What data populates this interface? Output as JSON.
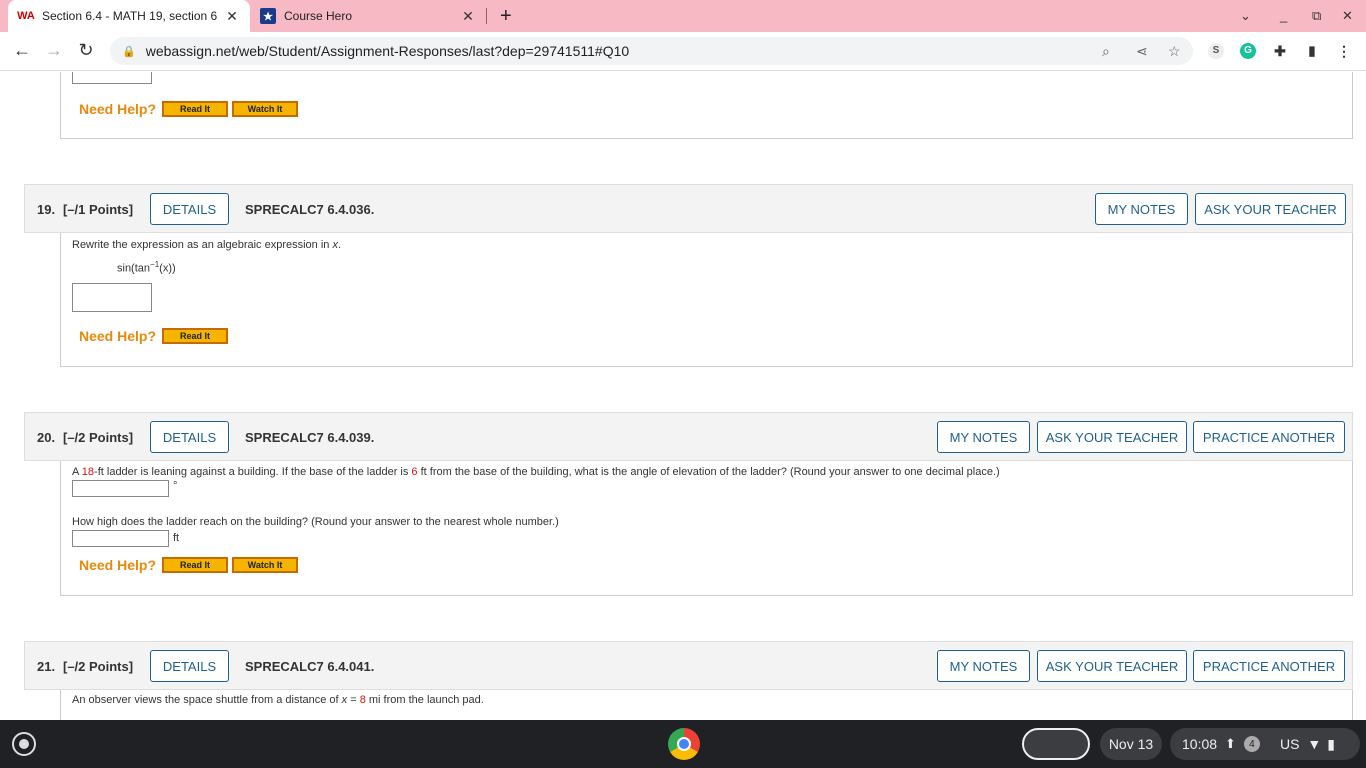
{
  "browser": {
    "tabs": [
      {
        "title": "Section 6.4 - MATH 19, section 6",
        "favicon": "webassign-icon"
      },
      {
        "title": "Course Hero",
        "favicon": "coursehero-icon"
      }
    ],
    "url": "webassign.net/web/Student/Assignment-Responses/last?dep=29741511#Q10",
    "new_tab": "+",
    "close": "✕"
  },
  "prev_question": {
    "need_help": "Need Help?",
    "read_it": "Read It",
    "watch_it": "Watch It"
  },
  "q19": {
    "num": "19.",
    "points": "[–/1 Points]",
    "details": "DETAILS",
    "code": "SPRECALC7 6.4.036.",
    "my_notes": "MY NOTES",
    "ask_teacher": "ASK YOUR TEACHER",
    "prompt": "Rewrite the expression as an algebraic expression in",
    "prompt_var": "x",
    "prompt_end": ".",
    "expression": "sin(tan",
    "exponent": "−1",
    "expression_end": "(x))",
    "need_help": "Need Help?",
    "read_it": "Read It"
  },
  "q20": {
    "num": "20.",
    "points": "[–/2 Points]",
    "details": "DETAILS",
    "code": "SPRECALC7 6.4.039.",
    "my_notes": "MY NOTES",
    "ask_teacher": "ASK YOUR TEACHER",
    "practice": "PRACTICE ANOTHER",
    "p1_a": "A",
    "p1_v1": "18",
    "p1_b": "-ft ladder is leaning against a building. If the base of the ladder is",
    "p1_v2": "6",
    "p1_c": "ft from the base of the building, what is the angle of elevation of the ladder? (Round your answer to one decimal place.)",
    "unit1": "°",
    "p2": "How high does the ladder reach on the building? (Round your answer to the nearest whole number.)",
    "unit2": "ft",
    "need_help": "Need Help?",
    "read_it": "Read It",
    "watch_it": "Watch It"
  },
  "q21": {
    "num": "21.",
    "points": "[–/2 Points]",
    "details": "DETAILS",
    "code": "SPRECALC7 6.4.041.",
    "my_notes": "MY NOTES",
    "ask_teacher": "ASK YOUR TEACHER",
    "practice": "PRACTICE ANOTHER",
    "p1_a": "An observer views the space shuttle from a distance of",
    "p1_var": "x",
    "p1_eq": "=",
    "p1_v": "8",
    "p1_b": "mi from the launch pad."
  },
  "shelf": {
    "date": "Nov 13",
    "time": "10:08",
    "notif_count": "4",
    "locale": "US"
  }
}
